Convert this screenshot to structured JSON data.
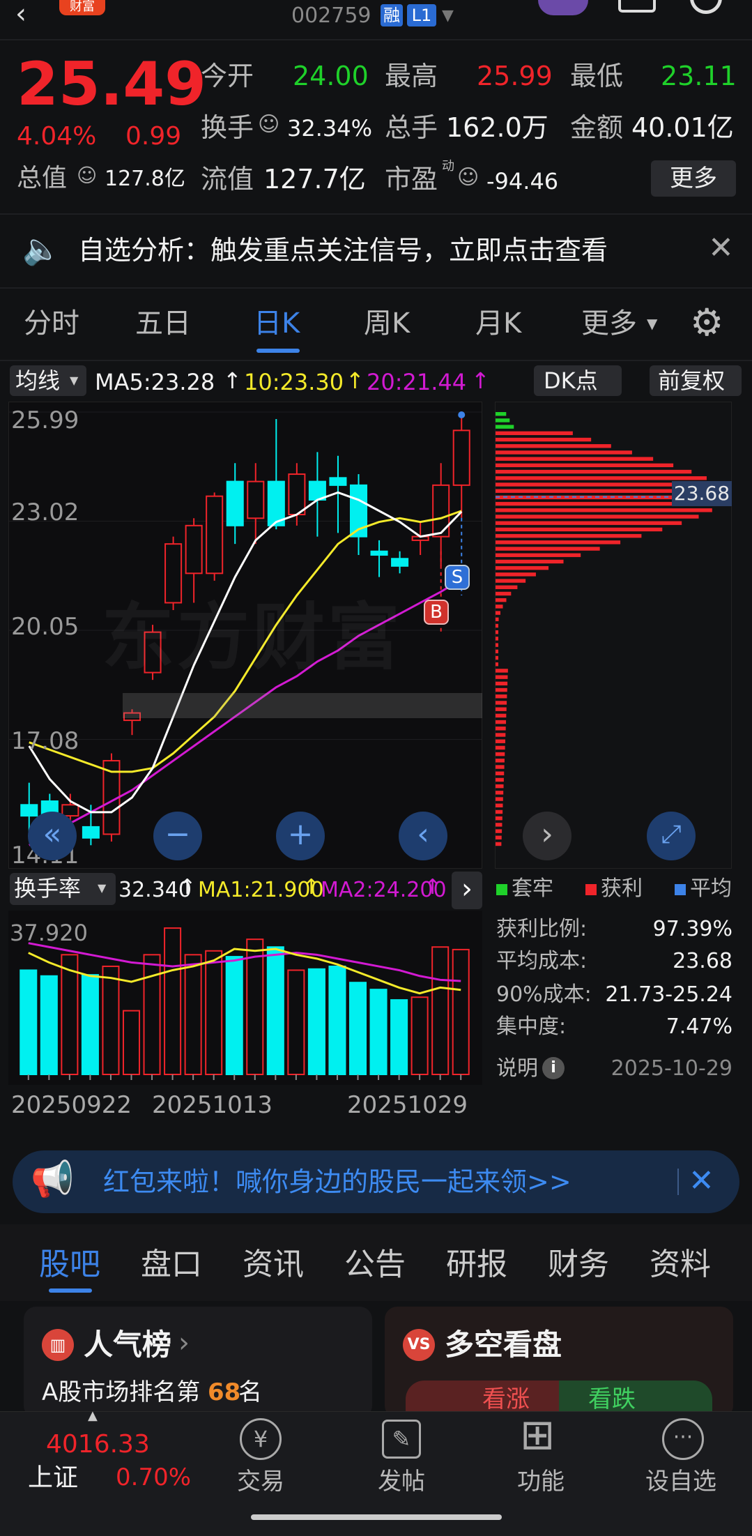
{
  "header": {
    "badge": "财富",
    "code": "002759",
    "rong": "融",
    "level": "L1"
  },
  "quote": {
    "price": "25.49",
    "change_pct": "4.04%",
    "change_amt": "0.99",
    "open_label": "今开",
    "open": "24.00",
    "high_label": "最高",
    "high": "25.99",
    "low_label": "最低",
    "low": "23.11",
    "turnover_label": "换手",
    "turnover": "32.34%",
    "volume_label": "总手",
    "volume": "162.0万",
    "amount_label": "金额",
    "amount": "40.01亿",
    "mcap_label": "总值",
    "mcap": "127.8亿",
    "float_label": "流值",
    "float": "127.7亿",
    "pe_label": "市盈",
    "pe_sup": "动",
    "pe": "-94.46",
    "more": "更多"
  },
  "notice": {
    "text": "自选分析：触发重点关注信号，立即点击查看"
  },
  "chart_tabs": [
    "分时",
    "五日",
    "日K",
    "周K",
    "月K",
    "更多"
  ],
  "selected_tab": "日K",
  "ma_bar": {
    "selector": "均线",
    "ma5": "MA5:23.28",
    "ma10": "10:23.30",
    "ma20": "20:21.44",
    "dk": "DK点",
    "fq": "前复权"
  },
  "price_axis": [
    "25.99",
    "23.02",
    "20.05",
    "17.08",
    "14.11"
  ],
  "sr_labels": {
    "s": "S",
    "b": "B"
  },
  "watermark": "东方财富",
  "cost_label": "23.68",
  "vol_bar": {
    "selector": "换手率",
    "value": "32.340",
    "ma1": "MA1:21.900",
    "ma2": "MA2:24.200"
  },
  "vol_axis": "37.920",
  "dates": [
    "20250922",
    "20251013",
    "20251029"
  ],
  "legend": {
    "trapped": "套牢",
    "profit": "获利",
    "avg": "平均"
  },
  "stats": [
    {
      "k": "获利比例:",
      "v": "97.39%"
    },
    {
      "k": "平均成本:",
      "v": "23.68"
    },
    {
      "k": "90%成本:",
      "v": "21.73-25.24"
    },
    {
      "k": "集中度:",
      "v": "7.47%"
    }
  ],
  "explain": {
    "label": "说明",
    "date": "2025-10-29"
  },
  "promo": {
    "text": "红包来啦！喊你身边的股民一起来领>>"
  },
  "bottom_tabs": [
    "股吧",
    "盘口",
    "资讯",
    "公告",
    "研报",
    "财务",
    "资料"
  ],
  "popular": {
    "title": "人气榜",
    "rank_prefix": "A股市场排名第",
    "rank": "68",
    "rank_suffix": "名"
  },
  "duokong": {
    "title": "多空看盘",
    "up": "看涨",
    "down": "看跌"
  },
  "nav": {
    "index_value": "4016.33",
    "index_name": "上证",
    "index_pct": "0.70%",
    "trade": "交易",
    "post": "发帖",
    "func": "功能",
    "watch": "设自选"
  },
  "colors": {
    "up": "#f0242a",
    "down": "#1fd12a",
    "accent": "#3d83e8",
    "cyan": "#00f0f0",
    "ma10": "#f4ea2a",
    "ma20": "#d21ad2"
  },
  "chart_data": {
    "type": "candlestick",
    "price_range": [
      14.11,
      25.99
    ],
    "candles": [
      {
        "o": 15.3,
        "h": 15.9,
        "l": 14.4,
        "c": 15.0
      },
      {
        "o": 15.4,
        "h": 15.6,
        "l": 14.2,
        "c": 14.5
      },
      {
        "o": 15.0,
        "h": 15.6,
        "l": 14.6,
        "c": 15.3
      },
      {
        "o": 14.7,
        "h": 15.3,
        "l": 14.2,
        "c": 14.4
      },
      {
        "o": 14.5,
        "h": 16.7,
        "l": 14.3,
        "c": 16.5
      },
      {
        "o": 17.6,
        "h": 17.9,
        "l": 17.2,
        "c": 17.8
      },
      {
        "o": 18.9,
        "h": 20.2,
        "l": 18.7,
        "c": 20.0
      },
      {
        "o": 20.8,
        "h": 22.6,
        "l": 20.6,
        "c": 22.4
      },
      {
        "o": 21.6,
        "h": 23.1,
        "l": 20.8,
        "c": 22.9
      },
      {
        "o": 21.6,
        "h": 23.8,
        "l": 21.4,
        "c": 23.7
      },
      {
        "o": 24.1,
        "h": 24.6,
        "l": 22.4,
        "c": 22.9
      },
      {
        "o": 23.1,
        "h": 24.6,
        "l": 22.4,
        "c": 24.1
      },
      {
        "o": 24.1,
        "h": 25.8,
        "l": 22.8,
        "c": 22.9
      },
      {
        "o": 23.2,
        "h": 24.6,
        "l": 22.9,
        "c": 24.3
      },
      {
        "o": 24.1,
        "h": 24.9,
        "l": 22.6,
        "c": 23.6
      },
      {
        "o": 24.2,
        "h": 24.8,
        "l": 22.7,
        "c": 24.0
      },
      {
        "o": 24.0,
        "h": 24.3,
        "l": 22.1,
        "c": 22.6
      },
      {
        "o": 22.2,
        "h": 22.5,
        "l": 21.5,
        "c": 22.1
      },
      {
        "o": 22.0,
        "h": 22.2,
        "l": 21.6,
        "c": 21.8
      },
      {
        "o": 22.5,
        "h": 23.0,
        "l": 22.1,
        "c": 22.6
      },
      {
        "o": 22.6,
        "h": 24.6,
        "l": 21.8,
        "c": 24.0
      },
      {
        "o": 24.0,
        "h": 25.99,
        "l": 23.11,
        "c": 25.49
      }
    ],
    "ma5": [
      16.9,
      16.0,
      15.4,
      15.1,
      15.1,
      15.5,
      16.3,
      17.7,
      19.1,
      20.3,
      21.5,
      22.5,
      23.0,
      23.2,
      23.6,
      23.8,
      23.6,
      23.3,
      23.0,
      22.6,
      22.7,
      23.28
    ],
    "ma10": [
      17.0,
      16.8,
      16.6,
      16.4,
      16.2,
      16.2,
      16.3,
      16.7,
      17.2,
      17.7,
      18.4,
      19.3,
      20.2,
      21.0,
      21.7,
      22.4,
      22.8,
      23.0,
      23.1,
      23.0,
      23.1,
      23.3
    ],
    "ma20": [
      14.2,
      14.5,
      14.8,
      15.1,
      15.4,
      15.7,
      16.1,
      16.5,
      16.9,
      17.3,
      17.7,
      18.1,
      18.5,
      18.8,
      19.2,
      19.5,
      19.9,
      20.2,
      20.5,
      20.8,
      21.1,
      21.44
    ],
    "turnover": [
      27.0,
      25.5,
      31.0,
      25.8,
      28.0,
      16.5,
      31.0,
      37.9,
      31.0,
      32.0,
      30.5,
      35.0,
      33.0,
      27.0,
      27.3,
      28.0,
      23.8,
      22.0,
      19.3,
      20.0,
      33.0,
      32.34
    ],
    "turnover_ma1": [
      31.5,
      29.0,
      27.0,
      25.5,
      25.0,
      24.0,
      25.5,
      27.0,
      28.0,
      29.5,
      32.5,
      32.0,
      32.5,
      31.0,
      30.0,
      28.5,
      26.5,
      24.5,
      22.5,
      21.0,
      22.5,
      21.9
    ],
    "turnover_ma2": [
      34.0,
      33.0,
      32.0,
      31.0,
      30.0,
      29.0,
      28.5,
      28.0,
      28.5,
      29.0,
      29.5,
      30.5,
      31.0,
      31.5,
      31.0,
      30.0,
      29.0,
      28.0,
      27.0,
      25.5,
      24.5,
      24.2
    ],
    "volume_profile_peak": 23.68
  }
}
